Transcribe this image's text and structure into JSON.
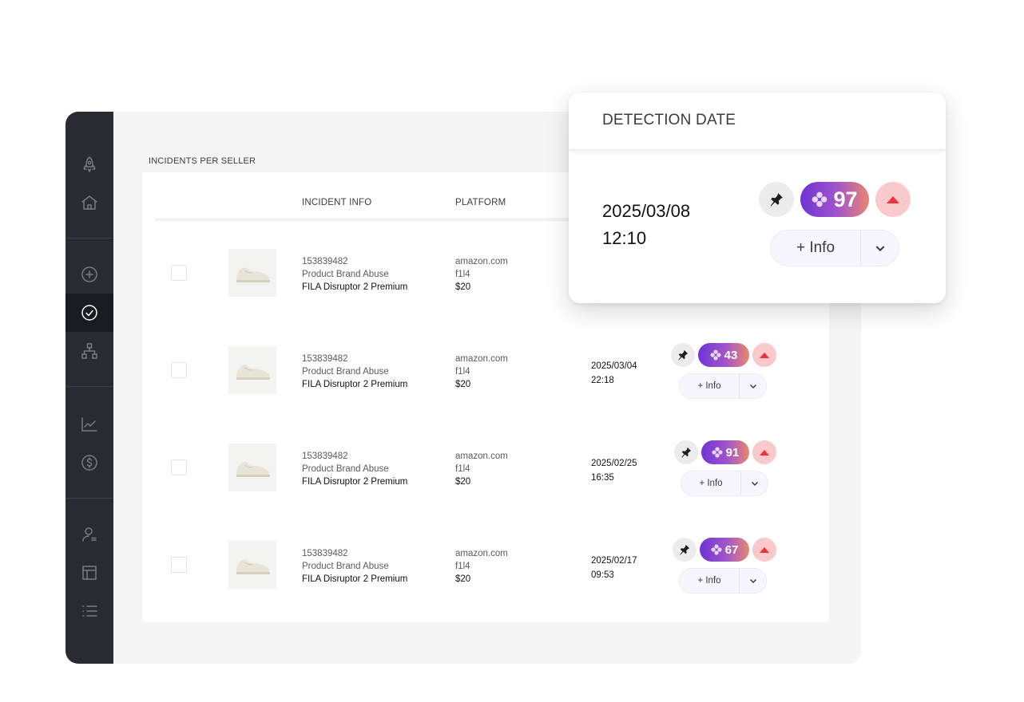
{
  "section_title": "INCIDENTS PER SELLER",
  "table": {
    "headers": {
      "incident_info": "INCIDENT INFO",
      "platform": "PLATFORM"
    },
    "rows": [
      {
        "id": "153839482",
        "type": "Product Brand Abuse",
        "product": "FILA  Disruptor 2 Premium",
        "platform": "amazon.com",
        "seller": "f1l4",
        "price": "$20",
        "date": "",
        "time": "",
        "score": ""
      },
      {
        "id": "153839482",
        "type": "Product Brand Abuse",
        "product": "FILA  Disruptor 2 Premium",
        "platform": "amazon.com",
        "seller": "f1l4",
        "price": "$20",
        "date": "2025/03/04",
        "time": "22:18",
        "score": "43",
        "info_label": "+ Info"
      },
      {
        "id": "153839482",
        "type": "Product Brand Abuse",
        "product": "FILA  Disruptor 2 Premium",
        "platform": "amazon.com",
        "seller": "f1l4",
        "price": "$20",
        "date": "2025/02/25",
        "time": "16:35",
        "score": "91",
        "info_label": "+ Info"
      },
      {
        "id": "153839482",
        "type": "Product Brand Abuse",
        "product": "FILA  Disruptor 2 Premium",
        "platform": "amazon.com",
        "seller": "f1l4",
        "price": "$20",
        "date": "2025/02/17",
        "time": "09:53",
        "score": "67",
        "info_label": "+ Info"
      }
    ]
  },
  "popup": {
    "header": "DETECTION DATE",
    "date": "2025/03/08",
    "time": "12:10",
    "score": "97",
    "info_label": "+ Info"
  },
  "sidebar": {
    "icons": [
      "rocket-icon",
      "home-icon",
      "add-circle-icon",
      "check-circle-icon",
      "hierarchy-icon",
      "line-chart-icon",
      "dollar-icon",
      "user-settings-icon",
      "layout-icon",
      "list-icon"
    ],
    "active": "check-circle-icon"
  },
  "colors": {
    "sidebar_bg": "#2a2a33",
    "score_gradient_start": "#6d34d6",
    "score_gradient_end": "#e9866e",
    "alert_red": "#f0303a",
    "alert_bg": "#f9c9cc"
  }
}
